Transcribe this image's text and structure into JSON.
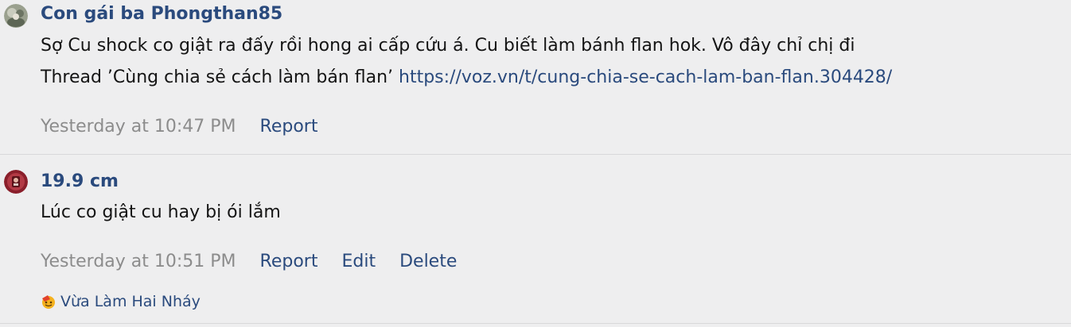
{
  "comments": [
    {
      "username": "Con gái ba Phongthan85",
      "avatar": "user-avatar-photo",
      "text_line1": "Sợ Cu shock co giật ra đấy rồi hong ai cấp cứu á. Cu biết làm bánh flan hok. Vô đây chỉ chị đi",
      "text_line2": "Thread ’Cùng chia sẻ cách làm bán flan’ ",
      "link": "https://voz.vn/t/cung-chia-se-cach-lam-ban-flan.304428/",
      "timestamp": "Yesterday at 10:47 PM",
      "actions": {
        "report": "Report"
      }
    },
    {
      "username": "19.9 cm",
      "avatar": "user-avatar-photo",
      "text_line1": "Lúc co giật cu hay bị ói lắm",
      "timestamp": "Yesterday at 10:51 PM",
      "actions": {
        "report": "Report",
        "edit": "Edit",
        "delete": "Delete"
      },
      "reaction": {
        "icon": "reaction-emoji-icon",
        "label": "Vừa Làm Hai Nháy"
      }
    }
  ],
  "colors": {
    "background": "#eeeeef",
    "link": "#2a4a7d",
    "timestamp": "#8c8c8c",
    "text": "#141414"
  }
}
